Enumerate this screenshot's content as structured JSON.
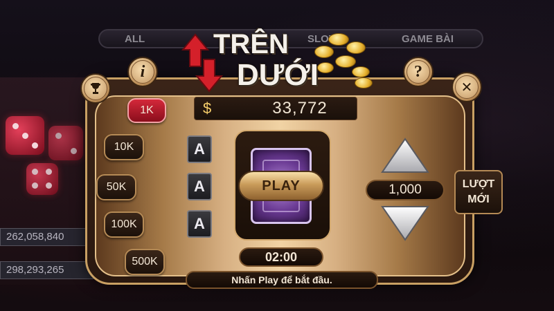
{
  "background": {
    "tabs": [
      {
        "label": "ALL"
      },
      {
        "label": "SLOT"
      },
      {
        "label": "GAME BÀI"
      }
    ],
    "counters": [
      "262,058,840",
      "298,293,265"
    ]
  },
  "logo": {
    "line1": "TRÊN",
    "line2": "DƯỚI"
  },
  "top_buttons": {
    "trophy_icon": "trophy-icon",
    "info_label": "i",
    "help_label": "?",
    "close_label": "✕"
  },
  "balance": {
    "currency": "$",
    "value": "33,772"
  },
  "chips": [
    {
      "label": "1K",
      "active": true
    },
    {
      "label": "10K",
      "active": false
    },
    {
      "label": "50K",
      "active": false
    },
    {
      "label": "100K",
      "active": false
    },
    {
      "label": "500K",
      "active": false
    }
  ],
  "cards": [
    "A",
    "A",
    "A"
  ],
  "play_button": "PLAY",
  "timer": "02:00",
  "bet_amount": "1,000",
  "new_round": {
    "line1": "LƯỢT",
    "line2": "MỚI"
  },
  "hint": "Nhấn Play để bắt đầu.",
  "colors": {
    "gold": "#c9a063",
    "active_chip": "#d4283a",
    "arrow_red": "#d4202a",
    "card_back": "#6a3a93"
  }
}
